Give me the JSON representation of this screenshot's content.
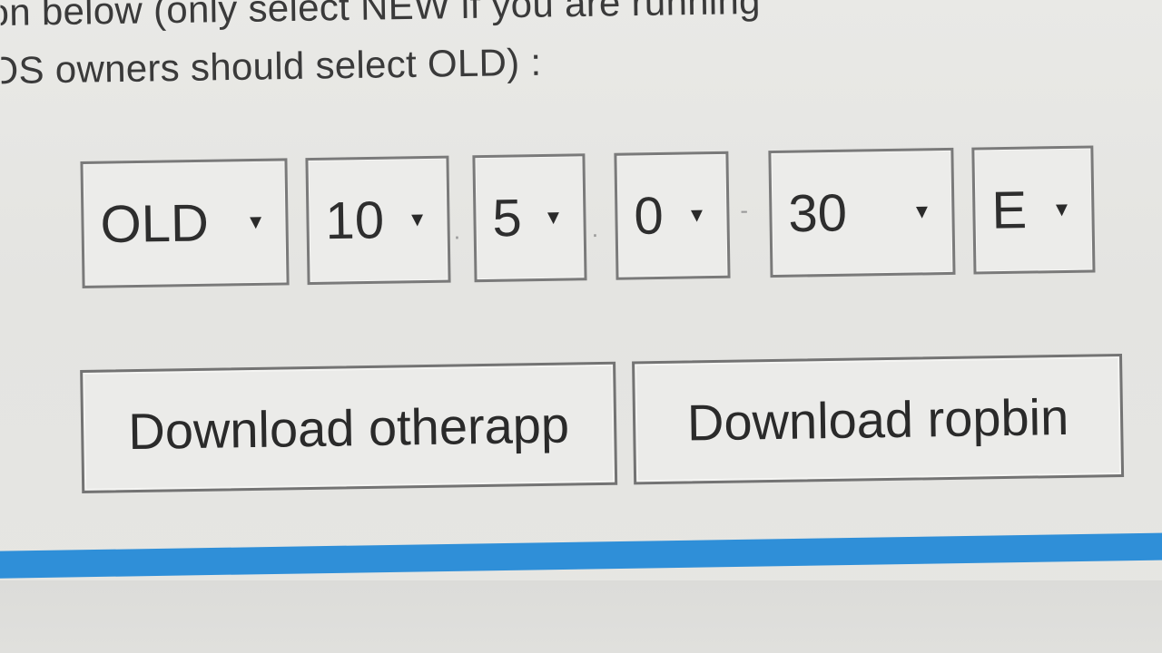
{
  "instructions": {
    "line1": "on below (only select NEW if you are running",
    "line2": "OS owners should select OLD) :"
  },
  "selects": {
    "model": {
      "value": "OLD"
    },
    "major": {
      "value": "10"
    },
    "minor": {
      "value": "5"
    },
    "revision": {
      "value": "0"
    },
    "nver": {
      "value": "30"
    },
    "region": {
      "value": "E"
    }
  },
  "separators": {
    "dot1": ".",
    "dot2": ".",
    "dash": "-"
  },
  "buttons": {
    "otherapp": "Download otherapp",
    "ropbin": "Download ropbin"
  },
  "colors": {
    "accent_bar": "#2f8fd8",
    "background": "#e6e6e3"
  },
  "icons": {
    "dropdown": "caret-down-icon"
  }
}
